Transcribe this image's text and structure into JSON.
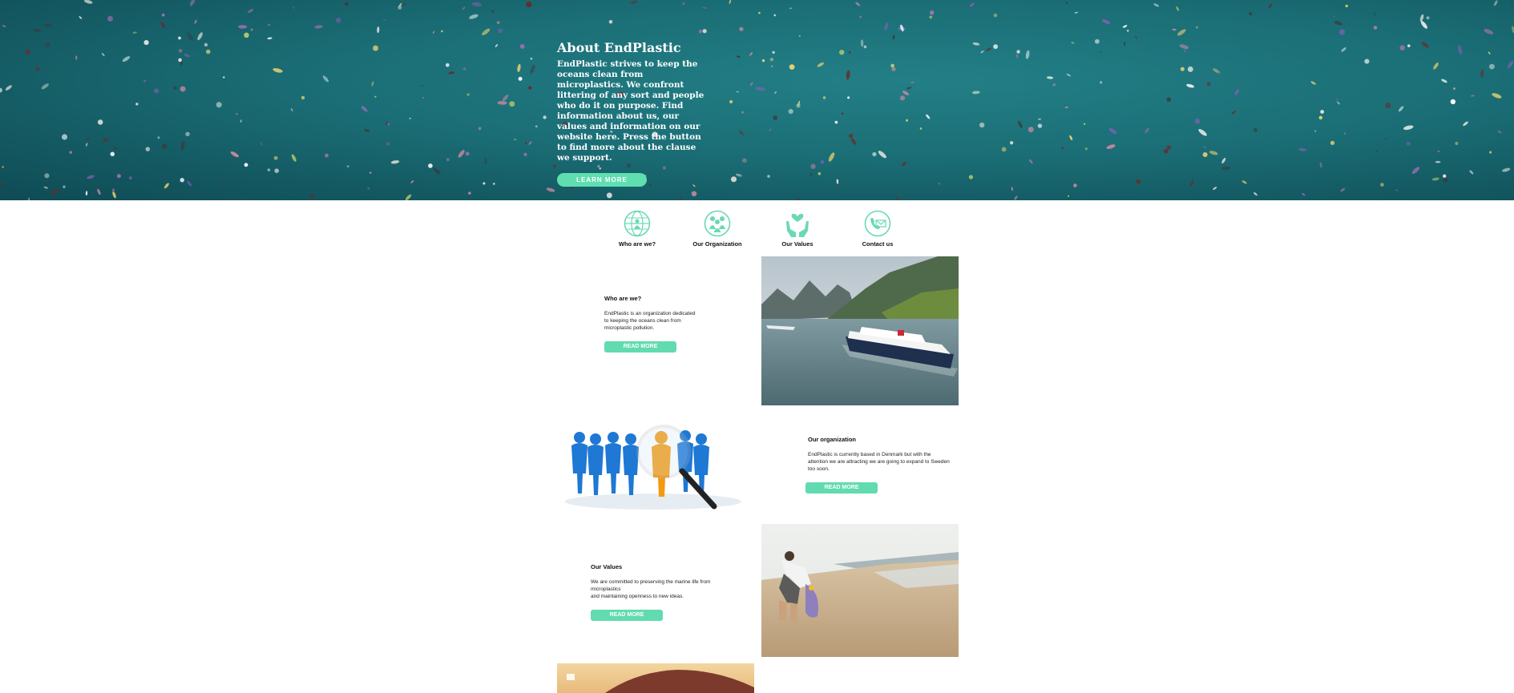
{
  "hero": {
    "title": "About EndPlastic",
    "text": "EndPlastic strives to keep the oceans clean from microplastics. We confront littering of any sort and people who do it on purpose. Find information about us, our values and information on our website here. Press the button to find more about the clause we support.",
    "button_label": "LEARN MORE"
  },
  "nav": {
    "items": [
      {
        "label": "Who are we?",
        "icon": "globe-icon"
      },
      {
        "label": "Our Organization",
        "icon": "people-icon"
      },
      {
        "label": "Our Values",
        "icon": "heart-hands-icon"
      },
      {
        "label": "Contact us",
        "icon": "envelope-icon"
      }
    ]
  },
  "sections": [
    {
      "title": "Who are we?",
      "body": "EndPlastic is an organization dedicated to keeping the oceans clean from microplastic pollution.",
      "button_label": "READ MORE"
    },
    {
      "title": "Our organization",
      "body": "EndPlastic is currently based in Denmark but with the attention we are attracting we are going to expand to Sweden too soon.",
      "button_label": "READ MORE"
    },
    {
      "title": "Our Values",
      "body_line1": "We are committed to preserving the marine life from microplastics",
      "body_line2": "and maintaining openness to new ideas.",
      "button_label": "READ MORE"
    }
  ],
  "colors": {
    "accent": "#5fdfb0",
    "hero_water": "#1b6e76"
  }
}
